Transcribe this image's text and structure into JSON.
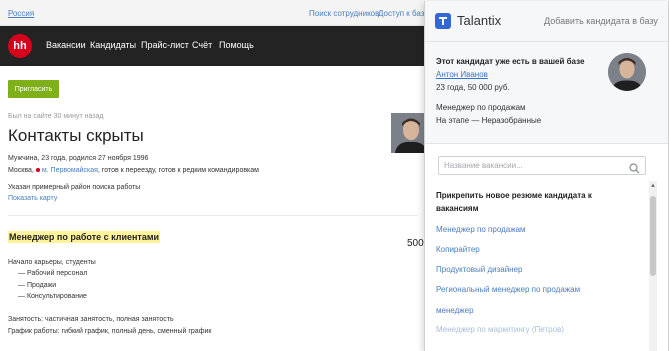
{
  "topbar": {
    "region": "Россия",
    "links": [
      "Поиск сотрудников",
      "Доступ к базе"
    ]
  },
  "nav": {
    "logo_text": "hh",
    "items": [
      "Вакансии",
      "Кандидаты",
      "Прайс-лист",
      "Счёт",
      "Помощь"
    ]
  },
  "resume": {
    "invite_button": "Пригласить",
    "last_seen": "Был на сайте 30 минут назад",
    "contacts_title": "Контакты скрыты",
    "personal": "Мужчина, 23 года, родился 27 ноября 1996",
    "city": "Москва,",
    "metro": "м. Первомайская",
    "relocation": ", готов к переезду, готов к редким командировкам",
    "area_note": "Указан примерный район поиска работы",
    "show_map": "Показать карту",
    "position_title": "Менеджер по работе с клиентами",
    "salary": "500",
    "career_start": "Начало карьеры, студенты",
    "specializations": [
      "— Рабочий персонал",
      "— Продажи",
      "— Консультирование"
    ],
    "employment": "Занятость: частичная занятость, полная занятость",
    "schedule": "График работы: гибкий график, полный день, сменный график"
  },
  "popup": {
    "brand": "Talantix",
    "brand_color": "#3466d6",
    "add_to_base": "Добавить кандидата в базу",
    "exists_heading": "Этот кандидат уже есть в вашей базе",
    "candidate_name": "Антон Иванов",
    "candidate_details": "23 года, 50 000 руб.",
    "candidate_position": "Менеджер по продажам",
    "candidate_stage": "На этапе — Неразобранные",
    "search_placeholder": "Название вакансии...",
    "attach_heading": "Прикрепить новое резюме кандидата к вакансиям",
    "vacancies": [
      "Менеджер по продажам",
      "Копирайтер",
      "Продуктовый дизайнер",
      "Региональный менеджер по продажам",
      "менеджер",
      "Менеджер по маркетингу (Петров)"
    ]
  },
  "colors": {
    "hh_red": "#d6001c",
    "invite_green": "#7fb019",
    "link_blue": "#4a7dbf",
    "highlight_yellow": "#fff49a"
  }
}
